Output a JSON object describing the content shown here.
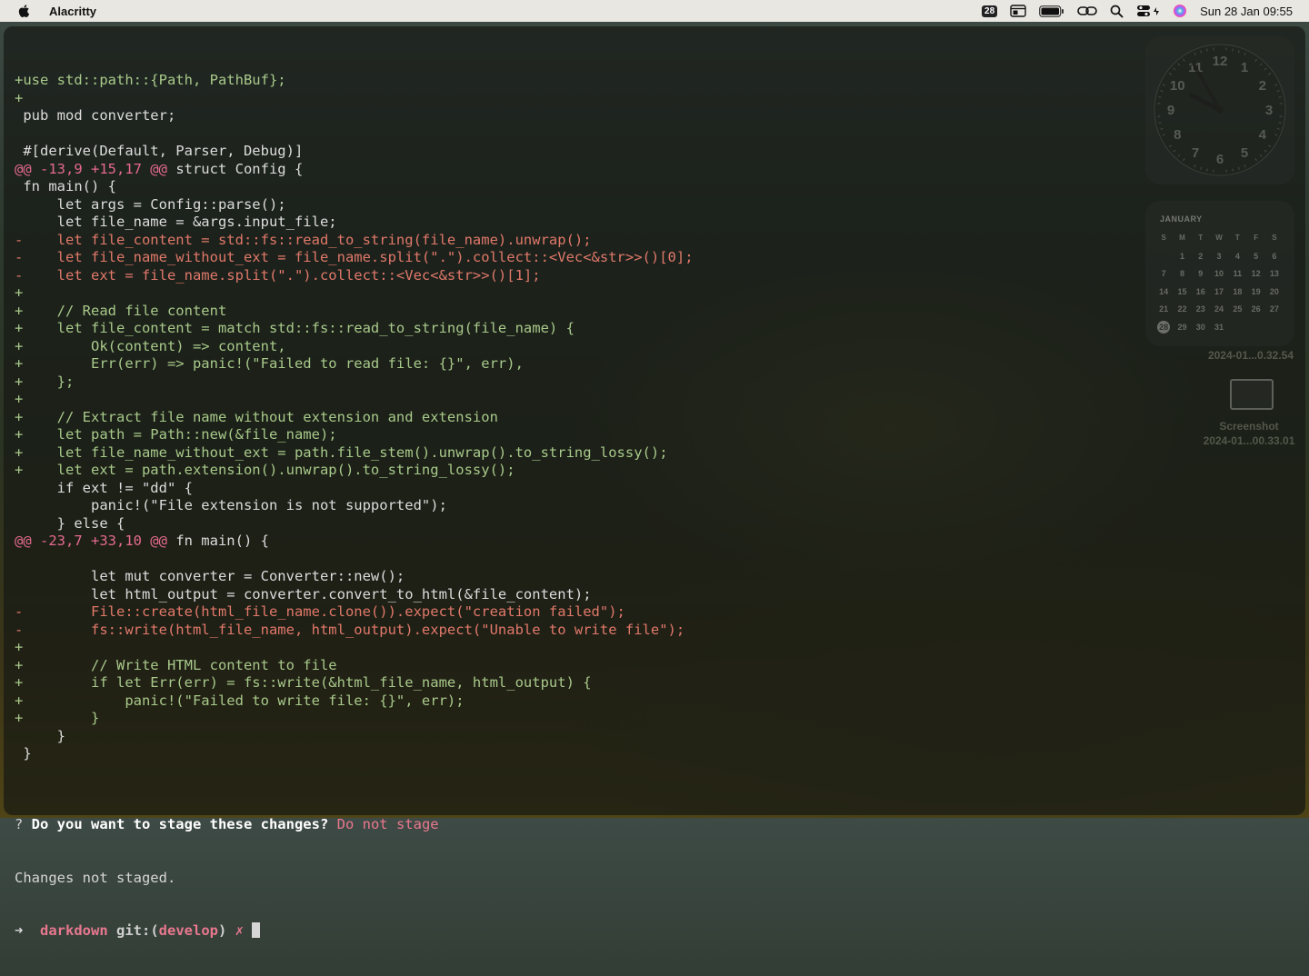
{
  "menubar": {
    "app_name": "Alacritty",
    "date_badge": "28",
    "datetime": "Sun 28 Jan  09:55"
  },
  "terminal": {
    "lines": [
      {
        "type": "add",
        "text": "+use std::path::{Path, PathBuf};"
      },
      {
        "type": "add",
        "text": "+"
      },
      {
        "type": "ctx",
        "text": " pub mod converter;"
      },
      {
        "type": "ctx",
        "text": ""
      },
      {
        "type": "ctx",
        "text": " #[derive(Default, Parser, Debug)]"
      },
      {
        "type": "hunk",
        "text": "@@ -13,9 +15,17 @@",
        "rest": " struct Config {"
      },
      {
        "type": "ctx",
        "text": " fn main() {"
      },
      {
        "type": "ctx",
        "text": "     let args = Config::parse();"
      },
      {
        "type": "ctx",
        "text": "     let file_name = &args.input_file;"
      },
      {
        "type": "del",
        "text": "-    let file_content = std::fs::read_to_string(file_name).unwrap();"
      },
      {
        "type": "del",
        "text": "-    let file_name_without_ext = file_name.split(\".\").collect::<Vec<&str>>()[0];"
      },
      {
        "type": "del",
        "text": "-    let ext = file_name.split(\".\").collect::<Vec<&str>>()[1];"
      },
      {
        "type": "add",
        "text": "+"
      },
      {
        "type": "add",
        "text": "+    // Read file content"
      },
      {
        "type": "add",
        "text": "+    let file_content = match std::fs::read_to_string(file_name) {"
      },
      {
        "type": "add",
        "text": "+        Ok(content) => content,"
      },
      {
        "type": "add",
        "text": "+        Err(err) => panic!(\"Failed to read file: {}\", err),"
      },
      {
        "type": "add",
        "text": "+    };"
      },
      {
        "type": "add",
        "text": "+"
      },
      {
        "type": "add",
        "text": "+    // Extract file name without extension and extension"
      },
      {
        "type": "add",
        "text": "+    let path = Path::new(&file_name);"
      },
      {
        "type": "add",
        "text": "+    let file_name_without_ext = path.file_stem().unwrap().to_string_lossy();"
      },
      {
        "type": "add",
        "text": "+    let ext = path.extension().unwrap().to_string_lossy();"
      },
      {
        "type": "ctx",
        "text": "     if ext != \"dd\" {"
      },
      {
        "type": "ctx",
        "text": "         panic!(\"File extension is not supported\");"
      },
      {
        "type": "ctx",
        "text": "     } else {"
      },
      {
        "type": "hunk",
        "text": "@@ -23,7 +33,10 @@",
        "rest": " fn main() {"
      },
      {
        "type": "ctx",
        "text": ""
      },
      {
        "type": "ctx",
        "text": "         let mut converter = Converter::new();"
      },
      {
        "type": "ctx",
        "text": "         let html_output = converter.convert_to_html(&file_content);"
      },
      {
        "type": "del",
        "text": "-        File::create(html_file_name.clone()).expect(\"creation failed\");"
      },
      {
        "type": "del",
        "text": "-        fs::write(html_file_name, html_output).expect(\"Unable to write file\");"
      },
      {
        "type": "add",
        "text": "+"
      },
      {
        "type": "add",
        "text": "+        // Write HTML content to file"
      },
      {
        "type": "add",
        "text": "+        if let Err(err) = fs::write(&html_file_name, html_output) {"
      },
      {
        "type": "add",
        "text": "+            panic!(\"Failed to write file: {}\", err);"
      },
      {
        "type": "add",
        "text": "+        }"
      },
      {
        "type": "ctx",
        "text": "     }"
      },
      {
        "type": "ctx",
        "text": " }"
      },
      {
        "type": "ctx",
        "text": ""
      }
    ],
    "prompt_question_mark": "? ",
    "prompt_question": "Do you want to stage these changes?",
    "prompt_answer": " Do not stage",
    "status_message": "Changes not staged.",
    "shell_arrow": "➜  ",
    "shell_dir": "darkdown",
    "shell_git": " git:(",
    "shell_branch": "develop",
    "shell_git_close": ")",
    "shell_dirty": " ✗ "
  },
  "calendar": {
    "month": "JANUARY",
    "weekdays": [
      "S",
      "M",
      "T",
      "W",
      "T",
      "F",
      "S"
    ],
    "days": [
      "",
      "1",
      "2",
      "3",
      "4",
      "5",
      "6",
      "7",
      "8",
      "9",
      "10",
      "11",
      "12",
      "13",
      "14",
      "15",
      "16",
      "17",
      "18",
      "19",
      "20",
      "21",
      "22",
      "23",
      "24",
      "25",
      "26",
      "27",
      "28",
      "29",
      "30",
      "31"
    ],
    "today": "28"
  },
  "desktop": {
    "file1_name": "2024-01...0.32.54",
    "file2_title": "Screenshot",
    "file2_name": "2024-01...00.33.01"
  },
  "clock": {
    "hour": 9,
    "minute": 55
  }
}
